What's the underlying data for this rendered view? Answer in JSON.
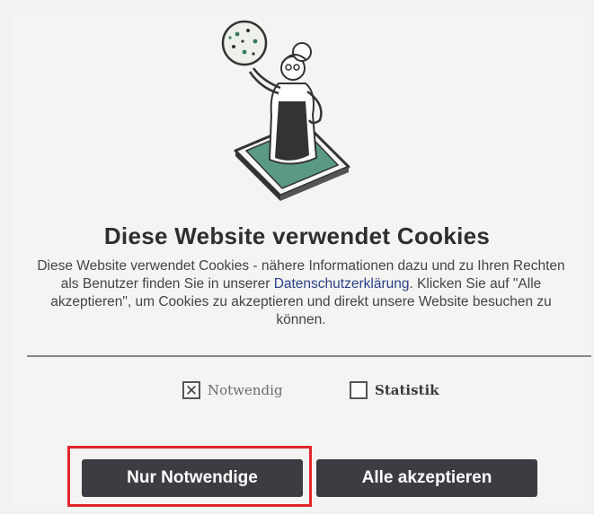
{
  "banner": {
    "title": "Diese Website verwendet Cookies",
    "desc_before": "Diese Website verwendet Cookies - nähere Informationen dazu und zu Ihren Rechten als Benutzer finden Sie in unserer ",
    "link_text": "Datenschutzerklärung",
    "desc_after": ". Klicken Sie auf \"Alle akzeptieren\", um Cookies zu akzeptieren und direkt unsere Website besuchen zu können."
  },
  "options": [
    {
      "label": "Notwendig",
      "checked": true,
      "disabled": true
    },
    {
      "label": "Statistik",
      "checked": false,
      "disabled": false
    }
  ],
  "buttons": {
    "necessary_label": "Nur Notwendige",
    "accept_label": "Alle akzeptieren"
  },
  "colors": {
    "button_bg": "#3c3d42",
    "link": "#2b3f8a",
    "highlight": "#e0262b",
    "phone_screen": "#5a9a84"
  },
  "icons": {
    "illustration": "baker-with-cookie-illustration",
    "checked_mark": "✕"
  }
}
